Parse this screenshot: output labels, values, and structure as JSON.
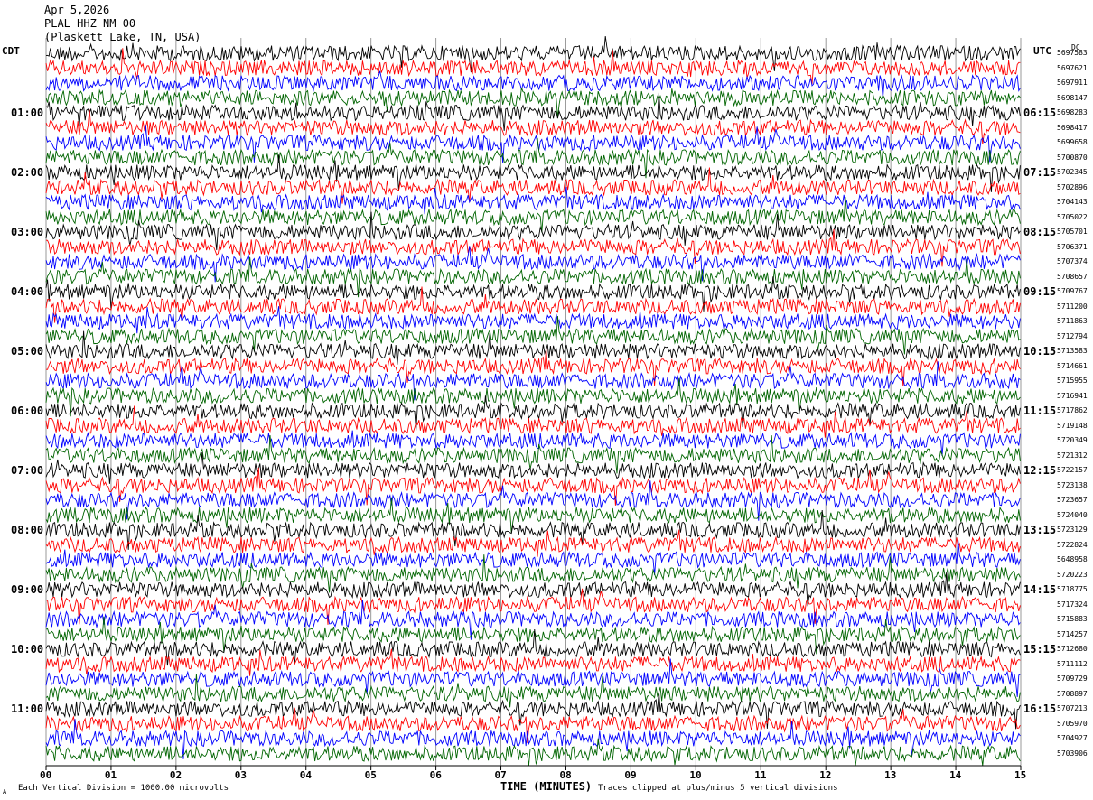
{
  "header": {
    "date": "Apr 5,2026",
    "station": "PLAL HHZ NM 00",
    "station_name": "(Plaskett Lake, TN, USA)"
  },
  "chart_data": {
    "type": "helicorder",
    "title": "Apr 5,2026",
    "xlabel": "TIME (MINUTES)",
    "xlim": [
      0,
      15
    ],
    "x_ticks": [
      "00",
      "01",
      "02",
      "03",
      "04",
      "05",
      "06",
      "07",
      "08",
      "09",
      "10",
      "11",
      "12",
      "13",
      "14",
      "15"
    ],
    "left_timezone": "CDT",
    "right_timezone": "UTC",
    "right_unit": "DC",
    "left_hour_labels": [
      "01:00",
      "02:00",
      "03:00",
      "04:00",
      "05:00",
      "06:00",
      "07:00",
      "08:00",
      "09:00",
      "10:00",
      "11:00"
    ],
    "right_hour_labels": [
      "06:15",
      "07:15",
      "08:15",
      "09:15",
      "10:15",
      "11:15",
      "12:15",
      "13:15",
      "14:15",
      "15:15",
      "16:15"
    ],
    "trace_colors": [
      "#000000",
      "#ff0000",
      "#0000ff",
      "#006400"
    ],
    "trace_mean_values": [
      "5697583",
      "5697621",
      "5697911",
      "5698147",
      "5698283",
      "5698417",
      "5699658",
      "5700870",
      "5702345",
      "5702896",
      "5704143",
      "5705022",
      "5705701",
      "5706371",
      "5707374",
      "5708657",
      "5709767",
      "5711200",
      "5711863",
      "5712794",
      "5713583",
      "5714661",
      "5715955",
      "5716941",
      "5717862",
      "5719148",
      "5720349",
      "5721312",
      "5722157",
      "5723138",
      "5723657",
      "5724040",
      "5723129",
      "5722824",
      "5648958",
      "5720223",
      "5718775",
      "5717324",
      "5715883",
      "5714257",
      "5712680",
      "5711112",
      "5709729",
      "5708897",
      "5707213",
      "5705970",
      "5704927",
      "5703906"
    ],
    "vertical_division_note": "Each Vertical Division = 1000.00 microvolts",
    "clip_note": "Traces clipped at plus/minus 5 vertical divisions",
    "grid": true
  },
  "footer": {
    "corner_mark": "A"
  }
}
